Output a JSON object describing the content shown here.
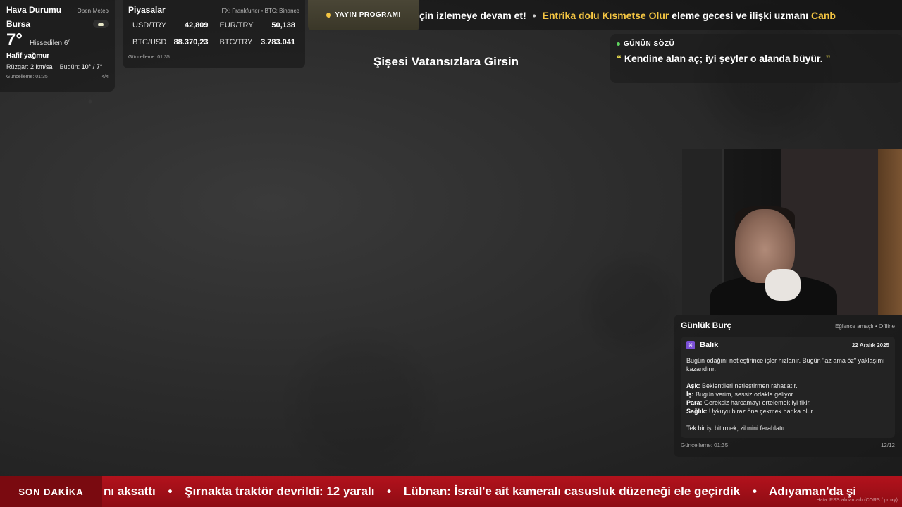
{
  "weather": {
    "title": "Hava Durumu",
    "source": "Open-Meteo",
    "city": "Bursa",
    "temperature": "7°",
    "feels_like": "Hissedilen 6°",
    "condition": "Hafif yağmur",
    "wind_label": "Rüzgar:",
    "wind_value": "2 km/sa",
    "today_label": "Bugün:",
    "today_value": "10° / 7°",
    "updated": "Güncelleme: 01:35",
    "page": "4/4",
    "icon": "rain-cloud-icon"
  },
  "markets": {
    "title": "Piyasalar",
    "source": "FX: Frankfurter • BTC: Binance",
    "pairs": [
      {
        "symbol": "USD/TRY",
        "value": "42,809"
      },
      {
        "symbol": "EUR/TRY",
        "value": "50,138"
      },
      {
        "symbol": "BTC/USD",
        "value": "88.370,23"
      },
      {
        "symbol": "BTC/TRY",
        "value": "3.783.041"
      }
    ],
    "updated": "Güncelleme: 01:35"
  },
  "schedule": {
    "label": "YAYIN PROGRAMI",
    "accent": "#f4c542"
  },
  "top_ticker": {
    "part1": "çin izlemeye devam et!",
    "highlight": "Entrika dolu Kısmetse Olur",
    "part2": "eleme gecesi ve ilişki uzmanı",
    "highlight2": "Canb",
    "separator": "•"
  },
  "stream_title": "Şişesi Vatansızlara Girsin",
  "quote": {
    "label": "GÜNÜN SÖZÜ",
    "open_mark": "“",
    "text": "Kendine alan aç; iyi şeyler o alanda büyür.",
    "close_mark": "”"
  },
  "horoscope": {
    "title": "Günlük Burç",
    "note": "Eğlence amaçlı • Offline",
    "sign": "Balık",
    "sign_symbol": "♓",
    "date": "22 Aralık 2025",
    "summary": "Bugün odağını netleştirince işler hızlanır. Bugün \"az ama öz\" yaklaşımı kazandırır.",
    "lines": [
      {
        "key": "Aşk:",
        "value": "Beklentileri netleştirmen rahatlatır."
      },
      {
        "key": "İş:",
        "value": "Bugün verim, sessiz odakla geliyor."
      },
      {
        "key": "Para:",
        "value": "Gereksiz harcamayı ertelemek iyi fikir."
      },
      {
        "key": "Sağlık:",
        "value": "Uykuyu biraz öne çekmek harika olur."
      }
    ],
    "tip": "Tek bir işi bitirmek, zihnini ferahlatır.",
    "updated": "Güncelleme: 01:35",
    "page": "12/12"
  },
  "breaking": {
    "label": "SON DAKİKA",
    "items": [
      "nı aksattı",
      "Şırnakta traktör devrildi: 12 yaralı",
      "Lübnan: İsrail'e ait kameralı casusluk düzeneği ele geçirdik",
      "Adıyaman'da şi"
    ],
    "separator": "•",
    "error": "Hata: RSS alınamadı (CORS / proxy)",
    "color": "#b3121c"
  }
}
